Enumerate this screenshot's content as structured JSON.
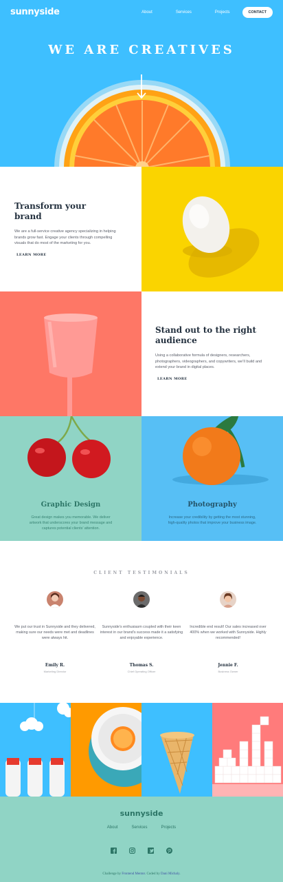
{
  "header": {
    "logo": "sunnyside",
    "nav": [
      "About",
      "Services",
      "Projects"
    ],
    "cta": "CONTACT"
  },
  "hero": {
    "title": "WE ARE CREATIVES"
  },
  "features": [
    {
      "title": "Transform your brand",
      "body": "We are a full-service creative agency specializing in helping brands grow fast. Engage your clients through compelling visuals that do most of the marketing for you.",
      "link": "LEARN MORE",
      "accent": "#fad400"
    },
    {
      "title": "Stand out to the right audience",
      "body": "Using a collaborative formula of designers, researchers, photographers, videographers, and copywriters, we’ll build and extend your brand in digital places.",
      "link": "LEARN MORE",
      "accent": "#fe7766"
    }
  ],
  "services": [
    {
      "title": "Graphic Design",
      "body": "Great design makes you memorable. We deliver artwork that underscores your brand message and captures potential clients’ attention.",
      "color": "#2c7566"
    },
    {
      "title": "Photography",
      "body": "Increase your credibility by getting the most stunning, high-quality photos that improve your business image.",
      "color": "#24546a"
    }
  ],
  "testimonials": {
    "heading": "CLIENT TESTIMONIALS",
    "items": [
      {
        "quote": "We put our trust in Sunnyside and they delivered, making sure our needs were met and deadlines were always hit.",
        "name": "Emily R.",
        "role": "Marketing Director"
      },
      {
        "quote": "Sunnyside’s enthusiasm coupled with their keen interest in our brand’s success made it a satisfying and enjoyable experience.",
        "name": "Thomas S.",
        "role": "Chief Operating Officer"
      },
      {
        "quote": "Incredible end result! Our sales increased over 400% when we worked with Sunnyside. Highly recommended!",
        "name": "Jennie F.",
        "role": "Business Owner"
      }
    ]
  },
  "footer": {
    "logo": "sunnyside",
    "nav": [
      "About",
      "Services",
      "Projects"
    ],
    "social": [
      "facebook-icon",
      "instagram-icon",
      "twitter-icon",
      "pinterest-icon"
    ],
    "attribution": {
      "prefix": "Challenge by",
      "challenge_link": "Frontend Mentor",
      "middle": ". Coded by",
      "author_link": "Dani Michaly",
      "suffix": "."
    }
  },
  "colors": {
    "hero_blue": "#3ebfff",
    "yellow": "#fad400",
    "coral": "#fe7766",
    "mint": "#90d4c5",
    "dark": "#23303e"
  }
}
